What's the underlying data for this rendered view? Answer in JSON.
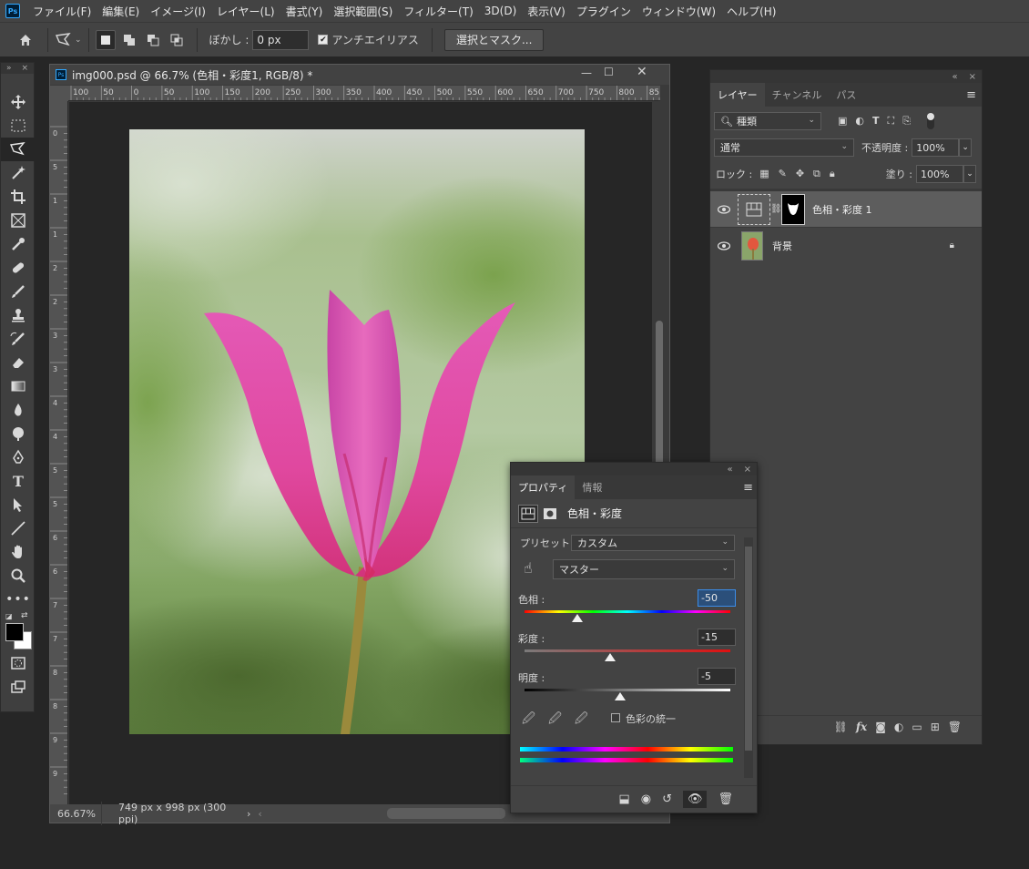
{
  "menubar": {
    "items": [
      "ファイル(F)",
      "編集(E)",
      "イメージ(I)",
      "レイヤー(L)",
      "書式(Y)",
      "選択範囲(S)",
      "フィルター(T)",
      "3D(D)",
      "表示(V)",
      "プラグイン",
      "ウィンドウ(W)",
      "ヘルプ(H)"
    ]
  },
  "options": {
    "feather_label": "ぼかし :",
    "feather_value": "0 px",
    "antialias_label": "アンチエイリアス",
    "select_mask_label": "選択とマスク..."
  },
  "toolbar": {
    "tools": [
      "move-tool",
      "marquee-tool",
      "polygon-lasso-tool",
      "magic-wand-tool",
      "crop-tool",
      "frame-tool",
      "eyedropper-tool",
      "healing-brush-tool",
      "brush-tool",
      "clone-stamp-tool",
      "history-brush-tool",
      "eraser-tool",
      "gradient-tool",
      "blur-tool",
      "dodge-tool",
      "pen-tool",
      "type-tool",
      "path-selection-tool",
      "line-tool",
      "hand-tool",
      "zoom-tool",
      "more-tools"
    ],
    "active_tool": "polygon-lasso-tool",
    "foreground_color": "#000000",
    "background_color": "#ffffff"
  },
  "document": {
    "title": "img000.psd @ 66.7% (色相・彩度1, RGB/8) *",
    "ruler_h_labels": [
      "100",
      "50",
      "0",
      "50",
      "100",
      "150",
      "200",
      "250",
      "300",
      "350",
      "400",
      "450",
      "500",
      "550",
      "600",
      "650",
      "700",
      "750",
      "800",
      "85"
    ],
    "ruler_v_labels": [
      "0",
      "5",
      "1",
      "1",
      "2",
      "2",
      "3",
      "3",
      "4",
      "4",
      "5",
      "5",
      "6",
      "6",
      "7",
      "7",
      "8",
      "8",
      "9",
      "9"
    ],
    "zoom": "66.67%",
    "info": "749 px x 998 px (300 ppi)"
  },
  "layers_panel": {
    "tabs": [
      "レイヤー",
      "チャンネル",
      "パス"
    ],
    "active_tab": "レイヤー",
    "filter_kind": "種類",
    "blend_mode": "通常",
    "opacity_label": "不透明度 :",
    "opacity_value": "100%",
    "lock_label": "ロック :",
    "fill_label": "塗り :",
    "fill_value": "100%",
    "layers": [
      {
        "name": "色相・彩度 1",
        "selected": true
      },
      {
        "name": "背景",
        "selected": false
      }
    ]
  },
  "properties_panel": {
    "tabs": [
      "プロパティ",
      "情報"
    ],
    "active_tab": "プロパティ",
    "title": "色相・彩度",
    "preset_label": "プリセット :",
    "preset_value": "カスタム",
    "channel_value": "マスター",
    "hue_label": "色相 :",
    "hue_value": "-50",
    "saturation_label": "彩度 :",
    "saturation_value": "-15",
    "lightness_label": "明度 :",
    "lightness_value": "-5",
    "colorize_label": "色彩の統一"
  }
}
